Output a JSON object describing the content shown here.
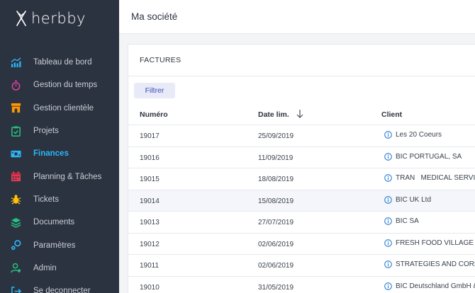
{
  "app": {
    "logo_text": "herbby"
  },
  "sidebar": {
    "items": [
      {
        "label": "Tableau de bord",
        "icon": "chart-icon",
        "color": "#29b6f6"
      },
      {
        "label": "Gestion du temps",
        "icon": "stopwatch-icon",
        "color": "#e040a0"
      },
      {
        "label": "Gestion clientèle",
        "icon": "storefront-icon",
        "color": "#ff9800"
      },
      {
        "label": "Projets",
        "icon": "clipboard-check-icon",
        "color": "#26c281"
      },
      {
        "label": "Finances",
        "icon": "money-icon",
        "color": "#29b6f6",
        "active": true
      },
      {
        "label": "Planning & Tâches",
        "icon": "calendar-icon",
        "color": "#e53950"
      },
      {
        "label": "Tickets",
        "icon": "bug-icon",
        "color": "#ffc107"
      },
      {
        "label": "Documents",
        "icon": "layers-icon",
        "color": "#26c281"
      },
      {
        "label": "Paramètres",
        "icon": "settings-icon",
        "color": "#29b6f6"
      },
      {
        "label": "Admin",
        "icon": "user-icon",
        "color": "#26c281"
      },
      {
        "label": "Se deconnecter",
        "icon": "logout-icon",
        "color": "#29b6f6"
      }
    ]
  },
  "header": {
    "title": "Ma société"
  },
  "invoices": {
    "title": "FACTURES",
    "filter_label": "Filtrer",
    "columns": {
      "numero": "Numéro",
      "date": "Date lim.",
      "client": "Client"
    },
    "rows": [
      {
        "numero": "19017",
        "date": "25/09/2019",
        "client": "Les 20 Coeurs"
      },
      {
        "numero": "19016",
        "date": "11/09/2019",
        "client": "BIC PORTUGAL, SA"
      },
      {
        "numero": "19015",
        "date": "18/08/2019",
        "client": "TRAN   MEDICAL SERVIC"
      },
      {
        "numero": "19014",
        "date": "15/08/2019",
        "client": "BIC UK Ltd"
      },
      {
        "numero": "19013",
        "date": "27/07/2019",
        "client": "BIC SA"
      },
      {
        "numero": "19012",
        "date": "02/06/2019",
        "client": "FRESH FOOD VILLAGE"
      },
      {
        "numero": "19011",
        "date": "02/06/2019",
        "client": "STRATEGIES AND CORP."
      },
      {
        "numero": "19010",
        "date": "31/05/2019",
        "client": "BIC Deutschland GmbH &"
      }
    ]
  },
  "colors": {
    "sidebar_bg": "#2c3340",
    "accent": "#29b6f6",
    "info_icon": "#2f80d1",
    "filter_bg": "#e8eaf7"
  }
}
